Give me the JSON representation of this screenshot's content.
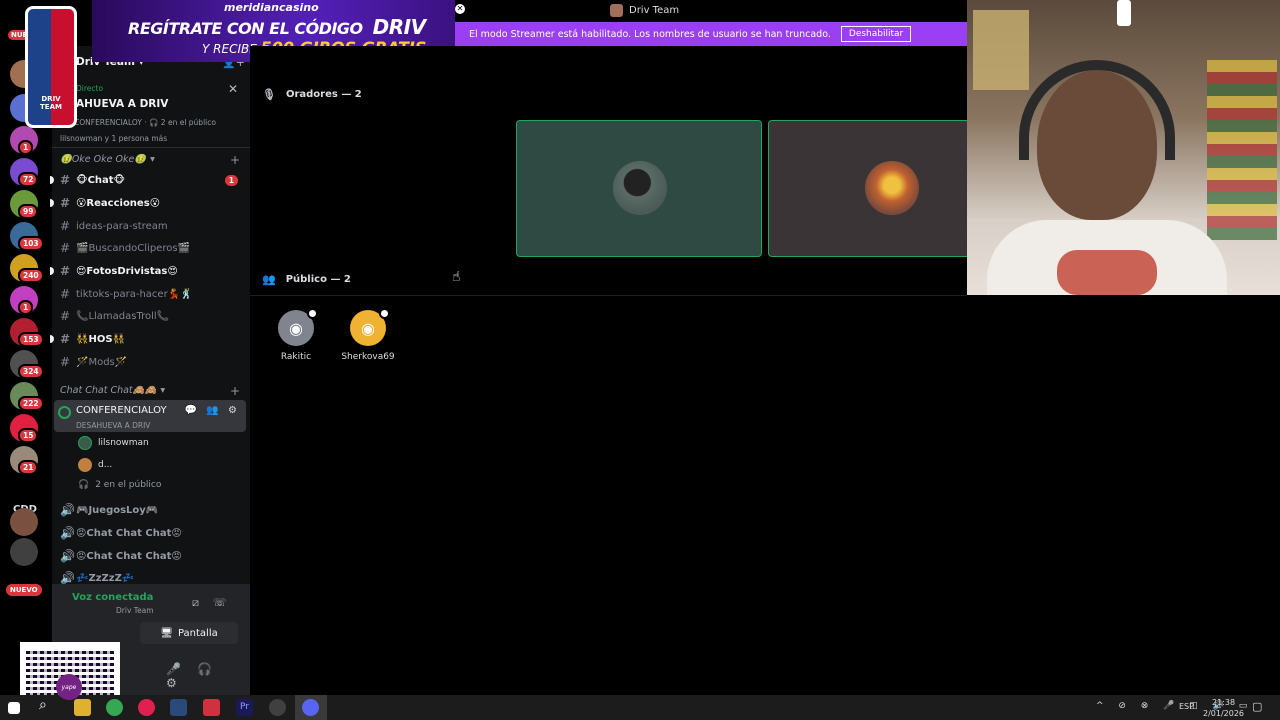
{
  "window": {
    "title": "Driv Team"
  },
  "streamer_banner": {
    "text": "El modo Streamer está habilitado. Los nombres de usuario se han truncado.",
    "button": "Deshabilitar"
  },
  "ad": {
    "brand": "meridiancasino",
    "line1": "REGÍTRATE CON EL CÓDIGO",
    "code": "DRIV",
    "line2_prefix": "Y RECIBE",
    "line2_highlight": "500 GIROS GRATIS"
  },
  "logo": {
    "text": "DRIV TEAM"
  },
  "rail": {
    "top_badge": "NUE",
    "badges": [
      "1",
      "72",
      "99",
      "103",
      "240",
      "1",
      "153",
      "324",
      "222",
      "15",
      "21"
    ],
    "text_server": "CDD",
    "nuevo": "NUEVO"
  },
  "sidebar": {
    "server_name": "Driv Team",
    "live": {
      "label": "Directo",
      "title": "AHUEVA A DRIV",
      "sub": "CONFERENCIALOY · 🎧 2 en el público",
      "people": "lilsnowman y 1 persona más"
    },
    "category1": "🤢Oke Oke Oke🤢",
    "channels": [
      {
        "name": "🐵Chat🐵",
        "unread": true,
        "mention": "1"
      },
      {
        "name": "😮Reacciones😮",
        "unread": true
      },
      {
        "name": "ideas-para-stream",
        "unread": false
      },
      {
        "name": "🎬BuscandoCliperos🎬",
        "unread": false
      },
      {
        "name": "😍FotosDrivistas😍",
        "unread": true
      },
      {
        "name": "tiktoks-para-hacer💃🕺",
        "unread": false
      },
      {
        "name": "📞LlamadasTroll📞",
        "unread": false
      },
      {
        "name": "👯HOS👯",
        "unread": true
      },
      {
        "name": "🪄Mods🪄",
        "unread": false
      }
    ],
    "category2": "Chat Chat Chat🙈🙈",
    "stage": {
      "name": "CONFERENCIALOY",
      "status": "DESAHUEVA A DRIV",
      "icons": "💬 👥 ⚙"
    },
    "stage_users": [
      "lilsnowman",
      "d..."
    ],
    "stage_audience": "2 en el público",
    "voice_channels": [
      "🎮JuegosLoy🎮",
      "😡Chat Chat Chat😡",
      "😡Chat Chat Chat😡",
      "💤ZzZzZ💤"
    ]
  },
  "voice_panel": {
    "status": "Voz conectada",
    "server": "Driv Team",
    "share": "Pantalla",
    "qr_label": "yape"
  },
  "main": {
    "speakers_header": "Oradores — 2",
    "audience_header": "Público — 2",
    "audience": [
      {
        "name": "Rakitic",
        "color": "#80848e"
      },
      {
        "name": "Sherkova69",
        "color": "#f0b232"
      }
    ]
  },
  "taskbar": {
    "lang": "ESP",
    "time": "21:38",
    "date": "2/01/2026"
  },
  "colors": {
    "accent_green": "#23a55a",
    "streamer_purple": "#9b3ff4",
    "mention_red": "#da373c"
  }
}
